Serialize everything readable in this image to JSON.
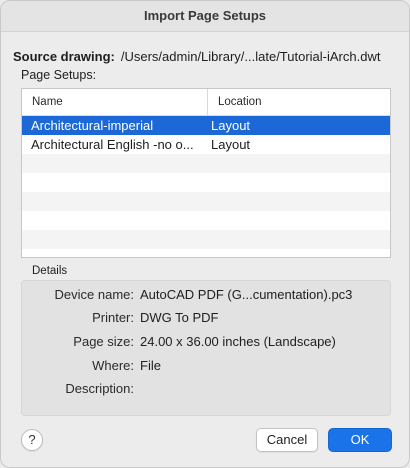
{
  "dialog": {
    "title": "Import Page Setups"
  },
  "source": {
    "label": "Source drawing:",
    "path": "/Users/admin/Library/...late/Tutorial-iArch.dwt"
  },
  "page_setups": {
    "label": "Page Setups:",
    "columns": [
      "Name",
      "Location"
    ],
    "rows": [
      {
        "name": "Architectural-imperial",
        "location": "Layout",
        "selected": true
      },
      {
        "name": "Architectural English -no o...",
        "location": "Layout",
        "selected": false
      }
    ]
  },
  "details": {
    "label": "Details",
    "device_name": {
      "key": "Device name:",
      "value": "AutoCAD PDF (G...cumentation).pc3"
    },
    "printer": {
      "key": "Printer:",
      "value": "DWG To PDF"
    },
    "page_size": {
      "key": "Page size:",
      "value": "24.00 x 36.00 inches (Landscape)"
    },
    "where": {
      "key": "Where:",
      "value": "File"
    },
    "description": {
      "key": "Description:",
      "value": ""
    }
  },
  "buttons": {
    "help": "?",
    "cancel": "Cancel",
    "ok": "OK"
  },
  "colors": {
    "selection": "#1b68d6",
    "primary_button": "#1a73e8"
  }
}
